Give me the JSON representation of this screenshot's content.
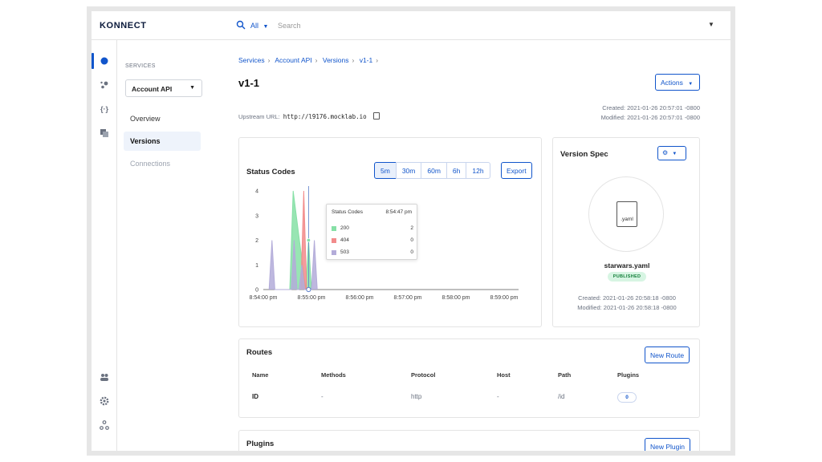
{
  "app": {
    "logo": "KONNECT"
  },
  "search": {
    "scope": "All",
    "placeholder": "Search"
  },
  "subnav": {
    "section_label": "SERVICES",
    "service": "Account API",
    "items": [
      {
        "label": "Overview",
        "state": "normal"
      },
      {
        "label": "Versions",
        "state": "active"
      },
      {
        "label": "Connections",
        "state": "muted"
      }
    ]
  },
  "breadcrumb": [
    "Services",
    "Account API",
    "Versions",
    "v1-1"
  ],
  "page": {
    "title": "v1-1",
    "actions_label": "Actions",
    "upstream_label": "Upstream URL:",
    "upstream_url": "http://l9176.mocklab.io",
    "created": "Created: 2021-01-26 20:57:01 -0800",
    "modified": "Modified: 2021-01-26 20:57:01 -0800"
  },
  "status_codes": {
    "title": "Status Codes",
    "ranges": [
      "5m",
      "30m",
      "60m",
      "6h",
      "12h"
    ],
    "active_range": "5m",
    "export_label": "Export",
    "tooltip": {
      "title": "Status Codes",
      "time": "8:54:47 pm",
      "rows": [
        {
          "name": "200",
          "value": "2",
          "color": "#86e0a6"
        },
        {
          "name": "404",
          "value": "0",
          "color": "#f28b8b"
        },
        {
          "name": "503",
          "value": "0",
          "color": "#b3acd9"
        }
      ]
    }
  },
  "chart_data": {
    "type": "area",
    "title": "Status Codes",
    "x_ticks": [
      "8:54:00 pm",
      "8:55:00 pm",
      "8:56:00 pm",
      "8:57:00 pm",
      "8:58:00 pm",
      "8:59:00 pm"
    ],
    "y_ticks": [
      "0",
      "1",
      "2",
      "3",
      "4"
    ],
    "ylim": [
      0,
      4
    ],
    "xlim_minutes": [
      0,
      5.3
    ],
    "series": [
      {
        "name": "200",
        "color": "#86e0a6",
        "x": [
          0.55,
          0.62,
          0.88,
          0.94,
          1.0
        ],
        "y": [
          0,
          4,
          0,
          2,
          0
        ]
      },
      {
        "name": "404",
        "color": "#f28b8b",
        "x": [
          0.78,
          0.84,
          0.9
        ],
        "y": [
          0,
          4,
          0
        ]
      },
      {
        "name": "503",
        "color": "#b3acd9",
        "x": [
          0.12,
          0.18,
          0.24,
          0.58,
          0.64,
          0.7,
          0.74,
          0.8,
          0.86,
          1.0,
          1.06,
          1.12
        ],
        "y": [
          0,
          2,
          0,
          0,
          2,
          0,
          0,
          1,
          0,
          0,
          2,
          0
        ]
      }
    ]
  },
  "version_spec": {
    "title": "Version Spec",
    "file_ext": ".yaml",
    "file_name": "starwars.yaml",
    "status": "PUBLISHED",
    "created": "Created: 2021-01-26 20:58:18 -0800",
    "modified": "Modified: 2021-01-26 20:58:18 -0800"
  },
  "routes": {
    "title": "Routes",
    "new_label": "New Route",
    "columns": [
      "Name",
      "Methods",
      "Protocol",
      "Host",
      "Path",
      "Plugins"
    ],
    "rows": [
      {
        "name": "ID",
        "methods": "-",
        "protocol": "http",
        "host": "-",
        "path": "/id",
        "plugins": "0"
      }
    ]
  },
  "plugins": {
    "title": "Plugins",
    "new_label": "New Plugin"
  },
  "colors": {
    "accent": "#1155cb",
    "published_bg": "#d7f5e3"
  }
}
